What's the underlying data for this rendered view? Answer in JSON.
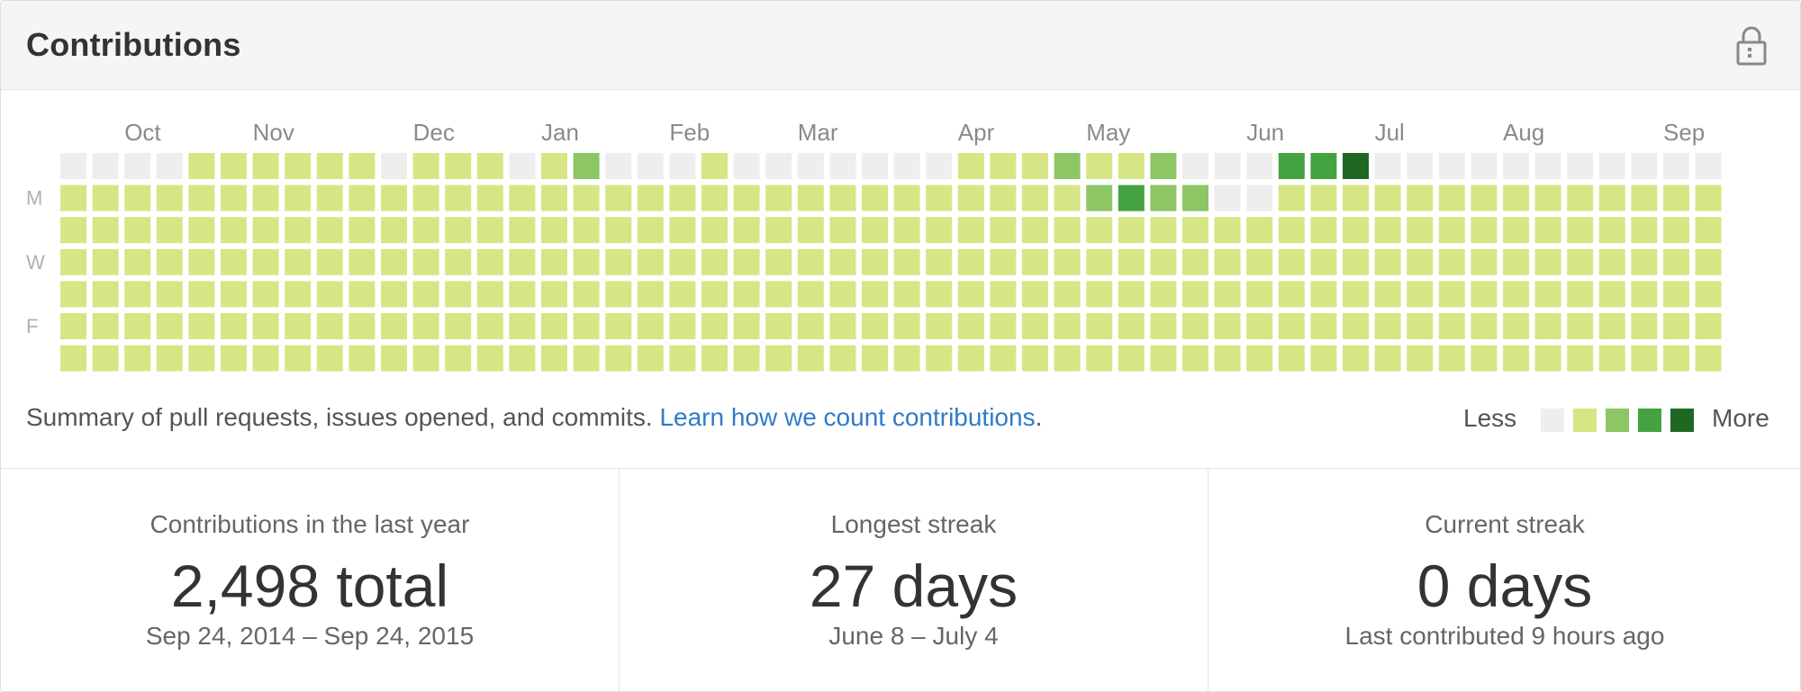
{
  "header": {
    "title": "Contributions",
    "lock_icon": "lock-icon"
  },
  "calendar": {
    "months": [
      "Oct",
      "Nov",
      "Dec",
      "Jan",
      "Feb",
      "Mar",
      "Apr",
      "May",
      "Jun",
      "Jul",
      "Aug",
      "Sep"
    ],
    "month_start_weeks": [
      2,
      6,
      11,
      15,
      19,
      23,
      28,
      32,
      37,
      41,
      45,
      50
    ],
    "day_labels": [
      "",
      "M",
      "",
      "W",
      "",
      "F",
      ""
    ],
    "levels": [
      "0000111111011101200010000000111211200033400000000000",
      "1111111111111111111111111111111123220011111111111111",
      "1111111111111111111111111111111111111111111111111111",
      "1111111111111111111111111111111111111111111111111111",
      "1111111111111111111111111111111111111111111111111111",
      "1111111111111111111111111111111111111111111111111111",
      "1111111111111111111111111111111111111111111111111111"
    ],
    "colors": [
      "#eeeeee",
      "#d6e685",
      "#8cc665",
      "#44a340",
      "#1e6823"
    ]
  },
  "summary": {
    "text": "Summary of pull requests, issues opened, and commits. ",
    "link": "Learn how we count contributions",
    "end": "."
  },
  "legend": {
    "less": "Less",
    "more": "More"
  },
  "stats": [
    {
      "title": "Contributions in the last year",
      "value": "2,498 total",
      "sub": "Sep 24, 2014 – Sep 24, 2015"
    },
    {
      "title": "Longest streak",
      "value": "27 days",
      "sub": "June 8 – July 4"
    },
    {
      "title": "Current streak",
      "value": "0 days",
      "sub": "Last contributed 9 hours ago"
    }
  ]
}
